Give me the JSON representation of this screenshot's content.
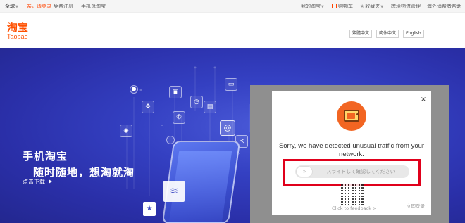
{
  "topbar": {
    "region": "全球",
    "login_prompt": "亲，请登录",
    "register": "免费注册",
    "mobile_site": "手机逛淘宝",
    "my_taobao": "我的淘宝",
    "cart": "购物车",
    "favorites": "收藏夹",
    "logistics": "跨境物流管理",
    "overseas_help": "海外消费者帮助"
  },
  "header": {
    "logo_cn": "淘宝",
    "logo_en": "Taobao",
    "languages": [
      "繁體中文",
      "简体中文",
      "English"
    ]
  },
  "hero": {
    "title_line1": "手机淘宝",
    "title_line2": "随时随地，想淘就淘",
    "cta": "点击下载"
  },
  "captcha_modal": {
    "close": "×",
    "message": "Sorry, we have detected unusual traffic from your network.",
    "slider_text": "スライドして確認してください",
    "slider_knob": "»",
    "feedback_link": "Click to feedback >",
    "login_now": "立即登录"
  },
  "colors": {
    "brand_orange": "#ff5000",
    "hero_blue": "#3440c2",
    "highlight_red": "#e0001b",
    "overlay_gray": "#8f8f8f"
  }
}
